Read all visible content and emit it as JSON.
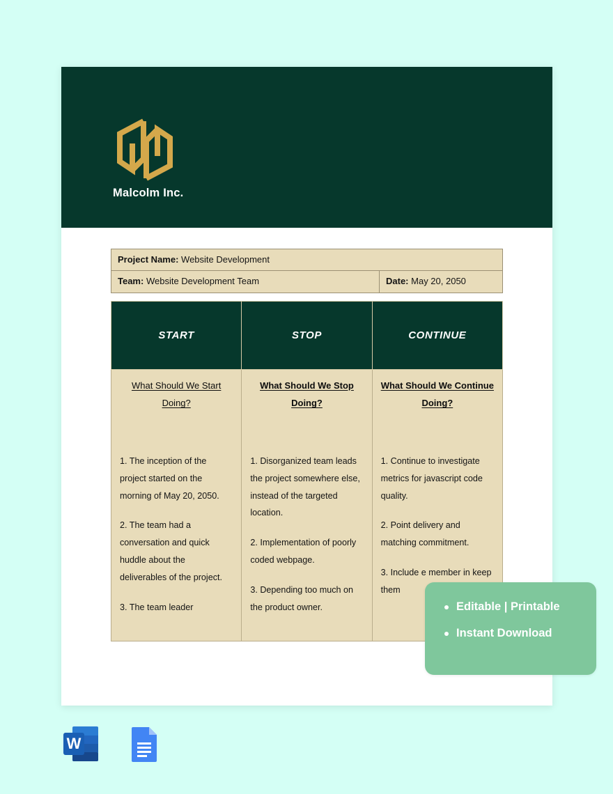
{
  "page": {
    "background_color": "#d4fff5",
    "sheet_color": "#ffffff"
  },
  "theme": {
    "dark_green": "#06382c",
    "gold": "#d4a84b",
    "beige": "#e8dcba",
    "promo_green": "#7fc79c",
    "mint": "#d4fff5"
  },
  "letterhead": {
    "logo_icon": "hexagon-monogram-logo",
    "brand_name": "Malcolm Inc."
  },
  "info": {
    "project_label": "Project Name:",
    "project_value": "Website Development",
    "team_label": "Team:",
    "team_value": "Website Development Team",
    "date_label": "Date:",
    "date_value": "May 20, 2050"
  },
  "table": {
    "columns": [
      {
        "header": "START",
        "subheader": "What Should We Start Doing?",
        "items": [
          "1. The inception of the project started on the morning of May 20, 2050.",
          "2. The team had a conversation and quick huddle about the deliverables of the project.",
          "3. The team leader"
        ]
      },
      {
        "header": "STOP",
        "subheader": "What Should We Stop Doing?",
        "items": [
          "1. Disorganized team leads the project somewhere else, instead of the targeted location.",
          "2. Implementation of poorly coded webpage.",
          "3. Depending too much on the product owner."
        ]
      },
      {
        "header": "CONTINUE",
        "subheader": "What Should We Continue Doing?",
        "items": [
          "1. Continue to investigate metrics for javascript code quality.",
          "2. Point delivery and matching commitment.",
          "3. Include e member in keep them"
        ]
      }
    ]
  },
  "promo": {
    "line1": "Editable | Printable",
    "line2": "Instant Download"
  },
  "formats": [
    {
      "icon": "microsoft-word-icon",
      "label": "Microsoft Word"
    },
    {
      "icon": "google-docs-icon",
      "label": "Google Docs"
    }
  ]
}
